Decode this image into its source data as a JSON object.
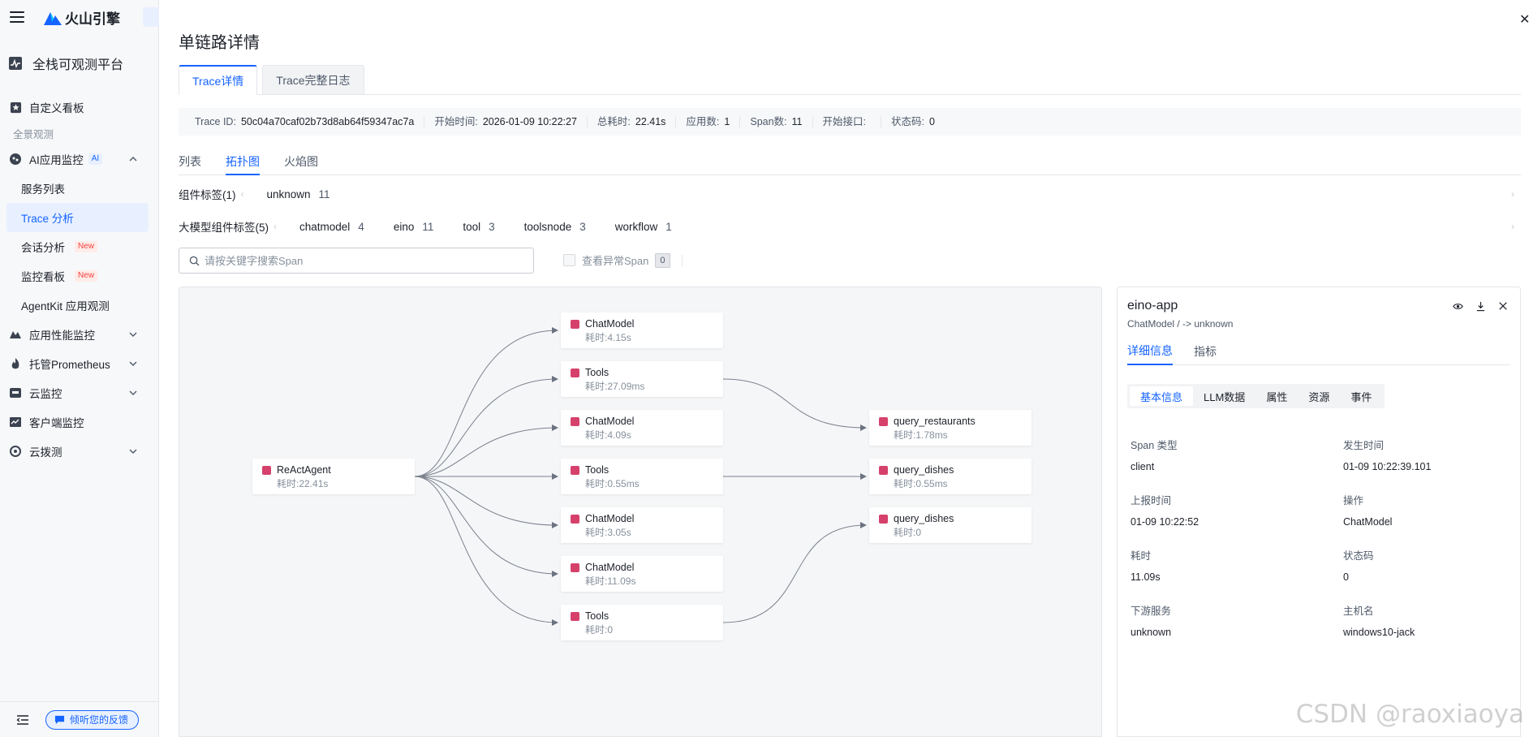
{
  "brand": {
    "name": "火山引擎"
  },
  "sidebar": {
    "platform": "全栈可观测平台",
    "custom_board": "自定义看板",
    "group_label": "全景观测",
    "ai_monitor": {
      "label": "AI应用监控",
      "badge": "AI"
    },
    "ai_subitems": [
      {
        "label": "服务列表"
      },
      {
        "label": "Trace 分析"
      },
      {
        "label": "会话分析",
        "badge": "New"
      },
      {
        "label": "监控看板",
        "badge": "New"
      },
      {
        "label": "AgentKit 应用观测"
      }
    ],
    "apm": "应用性能监控",
    "prometheus": "托管Prometheus",
    "cloud_monitor": "云监控",
    "client_monitor": "客户端监控",
    "probe": "云拨测",
    "feedback": "倾听您的反馈"
  },
  "page": {
    "title": "单链路详情",
    "tabs": [
      "Trace详情",
      "Trace完整日志"
    ]
  },
  "info": {
    "trace_id_label": "Trace ID:",
    "trace_id": "50c04a70caf02b73d8ab64f59347ac7a",
    "start_label": "开始时间:",
    "start": "2026-01-09 10:22:27",
    "total_label": "总耗时:",
    "total": "22.41s",
    "apps_label": "应用数:",
    "apps": "1",
    "spans_label": "Span数:",
    "spans": "11",
    "entry_label": "开始接口:",
    "entry": "",
    "status_label": "状态码:",
    "status": "0"
  },
  "views": [
    "列表",
    "拓扑图",
    "火焰图"
  ],
  "component_tags": {
    "label": "组件标签(1)",
    "chips": [
      {
        "name": "unknown",
        "count": "11"
      }
    ]
  },
  "llm_tags": {
    "label": "大模型组件标签(5)",
    "chips": [
      {
        "name": "chatmodel",
        "count": "4"
      },
      {
        "name": "eino",
        "count": "11"
      },
      {
        "name": "tool",
        "count": "3"
      },
      {
        "name": "toolsnode",
        "count": "3"
      },
      {
        "name": "workflow",
        "count": "1"
      }
    ]
  },
  "search": {
    "placeholder": "请按关键字搜索Span"
  },
  "abnormal": {
    "label": "查看异常Span",
    "count": "0"
  },
  "topology": {
    "nodes": [
      {
        "name": "ReActAgent",
        "time": "耗时:22.41s"
      },
      {
        "name": "ChatModel",
        "time": "耗时:4.15s"
      },
      {
        "name": "Tools",
        "time": "耗时:27.09ms"
      },
      {
        "name": "ChatModel",
        "time": "耗时:4.09s"
      },
      {
        "name": "Tools",
        "time": "耗时:0.55ms"
      },
      {
        "name": "ChatModel",
        "time": "耗时:3.05s"
      },
      {
        "name": "ChatModel",
        "time": "耗时:11.09s"
      },
      {
        "name": "Tools",
        "time": "耗时:0"
      },
      {
        "name": "query_restaurants",
        "time": "耗时:1.78ms"
      },
      {
        "name": "query_dishes",
        "time": "耗时:0.55ms"
      },
      {
        "name": "query_dishes",
        "time": "耗时:0"
      }
    ]
  },
  "detail": {
    "title": "eino-app",
    "subtitle": "ChatModel / -> unknown",
    "tabs": [
      "详细信息",
      "指标"
    ],
    "segments": [
      "基本信息",
      "LLM数据",
      "属性",
      "资源",
      "事件"
    ],
    "fields": [
      {
        "k": "Span 类型",
        "v": "client"
      },
      {
        "k": "发生时间",
        "v": "01-09 10:22:39.101"
      },
      {
        "k": "上报时间",
        "v": "01-09 10:22:52"
      },
      {
        "k": "操作",
        "v": "ChatModel"
      },
      {
        "k": "耗时",
        "v": "11.09s"
      },
      {
        "k": "状态码",
        "v": "0"
      },
      {
        "k": "下游服务",
        "v": "unknown"
      },
      {
        "k": "主机名",
        "v": "windows10-jack"
      }
    ]
  },
  "watermark": "CSDN @raoxiaoya",
  "colors": {
    "accent": "#1664ff",
    "node_marker": "#d6416c"
  }
}
